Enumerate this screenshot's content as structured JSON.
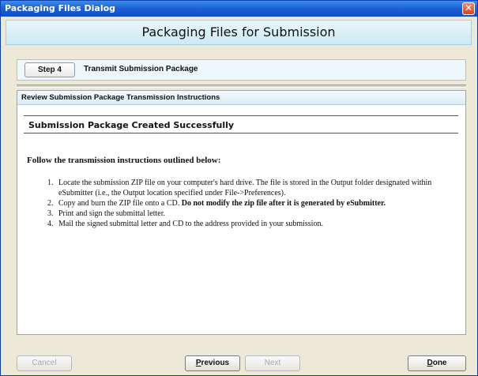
{
  "window": {
    "title": "Packaging Files Dialog",
    "close_glyph": "✕"
  },
  "banner": {
    "title": "Packaging Files for Submission"
  },
  "step": {
    "badge": "Step 4",
    "title": "Transmit Submission Package"
  },
  "content": {
    "header": "Review Submission Package Transmission Instructions",
    "success_message": "Submission Package Created Successfully",
    "intro": "Follow the transmission instructions outlined below:",
    "instructions": [
      {
        "num": "1.",
        "text": "Locate the submission ZIP file on your computer's hard drive. The file is stored in the Output folder designated within eSubmitter (i.e., the Output location specified under File->Preferences).",
        "bold": ""
      },
      {
        "num": "2.",
        "text": "Copy and burn the ZIP file onto a CD.",
        "bold": "Do not modify the zip file after it is generated by eSubmitter."
      },
      {
        "num": "3.",
        "text": "Print and sign the submittal letter.",
        "bold": ""
      },
      {
        "num": "4.",
        "text": "Mail the signed submittal letter and CD to the address provided in your submission.",
        "bold": ""
      }
    ]
  },
  "buttons": {
    "cancel": "Cancel",
    "previous_first": "P",
    "previous_rest": "revious",
    "next": "Next",
    "done_first": "D",
    "done_rest": "one"
  }
}
